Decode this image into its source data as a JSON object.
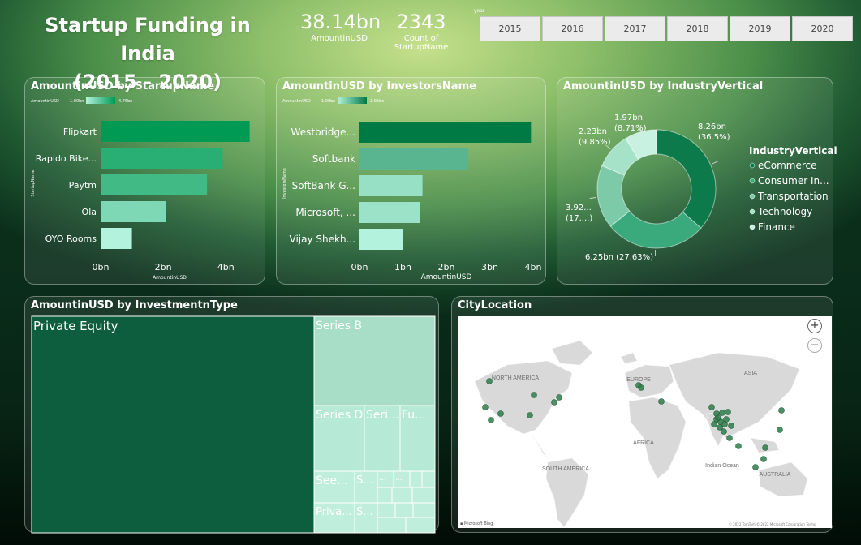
{
  "header": {
    "title_line1": "Startup Funding in India",
    "title_line2": "(2015 - 2020)"
  },
  "kpis": [
    {
      "value": "38.14bn",
      "label": "AmountinUSD"
    },
    {
      "value": "2343",
      "label": "Count of StartupName"
    }
  ],
  "year_slicer": {
    "label": "year",
    "options": [
      "2015",
      "2016",
      "2017",
      "2018",
      "2019",
      "2020"
    ]
  },
  "chart_data": [
    {
      "type": "bar",
      "orientation": "horizontal",
      "title": "AmountinUSD by StartupName",
      "legend": {
        "field": "AmountinUSD",
        "min_label": "1.00bn",
        "max_label": "4.76bn"
      },
      "categories": [
        "Flipkart",
        "Rapido Bike...",
        "Paytm",
        "Ola",
        "OYO Rooms"
      ],
      "values": [
        4.76,
        3.9,
        3.4,
        2.1,
        1.0
      ],
      "xlabel": "AmountinUSD",
      "ylabel": "StartupName",
      "xlim": [
        0,
        4.9
      ],
      "ticks": [
        {
          "v": 0,
          "label": "0bn"
        },
        {
          "v": 2,
          "label": "2bn"
        },
        {
          "v": 4,
          "label": "4bn"
        }
      ],
      "colors": {
        "low": "#b3f2dc",
        "high": "#009a55"
      }
    },
    {
      "type": "bar",
      "orientation": "horizontal",
      "title": "AmountinUSD by InvestorsName",
      "legend": {
        "field": "AmountinUSD",
        "min_label": "1.00bn",
        "max_label": "3.95bn"
      },
      "categories": [
        "Westbridge...",
        "Softbank",
        "SoftBank G...",
        "Microsoft, ...",
        "Vijay Shekh..."
      ],
      "values": [
        3.95,
        2.5,
        1.45,
        1.4,
        1.0
      ],
      "xlabel": "AmountinUSD",
      "ylabel": "InvestorsName",
      "xlim": [
        0,
        4
      ],
      "ticks": [
        {
          "v": 0,
          "label": "0bn"
        },
        {
          "v": 1,
          "label": "1bn"
        },
        {
          "v": 2,
          "label": "2bn"
        },
        {
          "v": 3,
          "label": "3bn"
        },
        {
          "v": 4,
          "label": "4bn"
        }
      ],
      "colors": {
        "low": "#b3f2dc",
        "high": "#007a45"
      }
    },
    {
      "type": "pie",
      "donut": true,
      "title": "AmountinUSD by IndustryVertical",
      "legend_title": "IndustryVertical",
      "legend_position": "right",
      "series": [
        {
          "name": "eCommerce",
          "value": 8.26,
          "label": "8.26bn",
          "pct": "(36.5%)",
          "color": "#0c7a4a"
        },
        {
          "name": "Consumer In...",
          "value": 6.25,
          "label": "6.25bn (27.63%)",
          "pct": "",
          "color": "#3aaa7c"
        },
        {
          "name": "Transportation",
          "value": 3.92,
          "label": "3.92...",
          "pct": "(17....)",
          "color": "#7dcaa8"
        },
        {
          "name": "Technology",
          "value": 2.23,
          "label": "2.23bn",
          "pct": "(9.85%)",
          "color": "#a6e2c8"
        },
        {
          "name": "Finance",
          "value": 1.97,
          "label": "1.97bn",
          "pct": "(8.71%)",
          "color": "#c8f1e2"
        }
      ]
    },
    {
      "type": "treemap",
      "title": "AmountinUSD by InvestmentnType",
      "tiles": [
        {
          "label": "Private Equity"
        },
        {
          "label": "Series B"
        },
        {
          "label": "Series D"
        },
        {
          "label": "Seri..."
        },
        {
          "label": "Fu..."
        },
        {
          "label": "See..."
        },
        {
          "label": "S..."
        },
        {
          "label": "..."
        },
        {
          "label": "..."
        },
        {
          "label": "Priva..."
        },
        {
          "label": "S..."
        }
      ]
    }
  ],
  "map": {
    "title": "CityLocation",
    "dot_color": "#2f7d4a",
    "region_labels": [
      "NORTH AMERICA",
      "EUROPE",
      "ASIA",
      "AFRICA",
      "SOUTH AMERICA",
      "AUSTRALIA",
      "Indian Ocean"
    ],
    "zoom_in": "+",
    "zoom_out": "−"
  }
}
